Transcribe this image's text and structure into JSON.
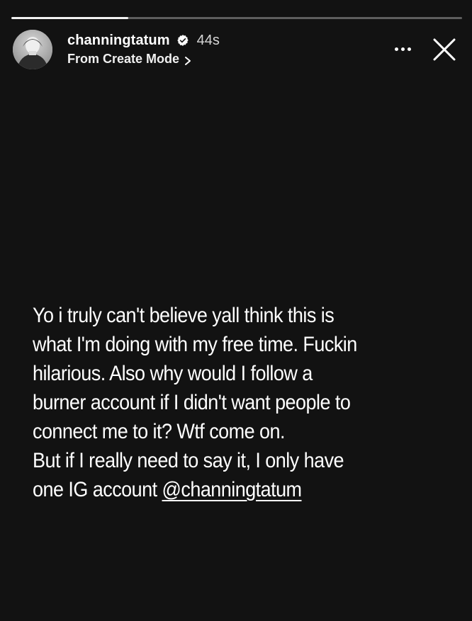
{
  "story": {
    "progress": 0.26,
    "user": {
      "username": "channingtatum",
      "verified": true,
      "time_ago": "44s",
      "source": "From Create Mode"
    },
    "text": {
      "lines": [
        "Yo i truly can't believe yall think this is",
        "what I'm doing with my free time. Fuckin",
        "hilarious. Also why would I follow a",
        "burner account if I didn't want people to",
        "connect me to it? Wtf come on.",
        "But if I really need to say it, I only have"
      ],
      "last_line_prefix": "one IG account ",
      "mention": "@channingtatum"
    },
    "icons": {
      "verified": "verified-badge-icon",
      "source_arrow": "chevron-right-icon",
      "more": "more-options-icon",
      "close": "close-icon"
    },
    "colors": {
      "background": "#121212",
      "text": "#ffffff",
      "progress_track": "rgba(255,255,255,0.32)",
      "progress_fill": "#f2f2f2"
    }
  }
}
